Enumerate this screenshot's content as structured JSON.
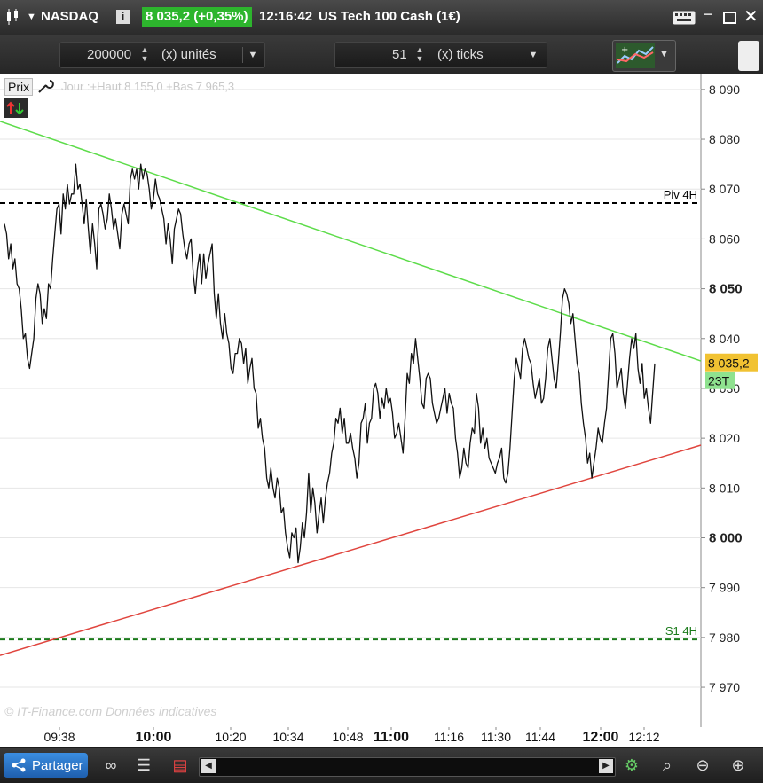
{
  "titlebar": {
    "market": "NASDAQ",
    "info_label": "i",
    "price_badge": "8 035,2 (+0,35%)",
    "time": "12:16:42",
    "instrument": "US Tech 100 Cash (1€)",
    "keyboard_icon": "keyboard-icon",
    "minimize_icon": "minimize-icon",
    "maximize_icon": "maximize-icon",
    "close_icon": "close-icon"
  },
  "toolbar": {
    "quantity": {
      "value": "200000",
      "unit_label": "(x) unités"
    },
    "ticks": {
      "value": "51",
      "unit_label": "(x) ticks"
    },
    "indicator_icon": "indicator-icon"
  },
  "chart_header": {
    "label": "Prix",
    "tool_icon": "wrench-icon",
    "day_info": "Jour :+Haut 8 155,0 +Bas 7 965,3",
    "arrows_icon": "up-down-arrows-icon"
  },
  "watermark": "© IT-Finance.com  Données indicatives",
  "colors": {
    "resistance": "#5ddc4a",
    "support": "#e0453e",
    "pivot": "#000000",
    "s1": "#1a7a1a",
    "price_tag": "#f1c232",
    "ticks_tag": "#8fe28f"
  },
  "chart_data": {
    "type": "line",
    "y_ticks": [
      "8 090",
      "8 080",
      "8 070",
      "8 060",
      "8 050",
      "8 040",
      "8 030",
      "8 020",
      "8 010",
      "8 000",
      "7 990",
      "7 980",
      "7 970"
    ],
    "y_tick_values": [
      8090,
      8080,
      8070,
      8060,
      8050,
      8040,
      8030,
      8020,
      8010,
      8000,
      7990,
      7980,
      7970
    ],
    "bold_ticks": [
      8050,
      8000
    ],
    "ylim": [
      7962,
      8093
    ],
    "x_ticks": [
      {
        "label": "09:38",
        "bold": false
      },
      {
        "label": "10:00",
        "bold": true
      },
      {
        "label": "10:20",
        "bold": false
      },
      {
        "label": "10:34",
        "bold": false
      },
      {
        "label": "10:48",
        "bold": false
      },
      {
        "label": "11:00",
        "bold": true
      },
      {
        "label": "11:16",
        "bold": false
      },
      {
        "label": "11:30",
        "bold": false
      },
      {
        "label": "11:44",
        "bold": false
      },
      {
        "label": "12:00",
        "bold": true
      },
      {
        "label": "12:12",
        "bold": false
      }
    ],
    "current_price": {
      "value": 8035.2,
      "label": "8 035,2"
    },
    "ticks_label": "23T",
    "pivot_lines": [
      {
        "name": "Piv 4H",
        "value": 8067.2,
        "color": "#000000"
      },
      {
        "name": "S1 4H",
        "value": 7979.6,
        "color": "#1a7a1a"
      }
    ],
    "trendlines": [
      {
        "role": "resistance",
        "from": [
          0,
          8083.6
        ],
        "to": [
          146,
          8035.5
        ],
        "color": "#5ddc4a"
      },
      {
        "role": "support",
        "from": [
          0,
          7976.4
        ],
        "to": [
          146,
          8018.6
        ],
        "color": "#e0453e"
      }
    ],
    "series": [
      {
        "values": [
          8063,
          8061,
          8056,
          8059,
          8054,
          8056,
          8051,
          8050,
          8046,
          8040,
          8041,
          8036,
          8034,
          8037,
          8040,
          8048,
          8051,
          8049,
          8043,
          8046,
          8044,
          8051,
          8050,
          8056,
          8061,
          8066,
          8067,
          8061,
          8069,
          8066,
          8071,
          8067,
          8069,
          8069,
          8075,
          8070,
          8071,
          8067,
          8063,
          8068,
          8062,
          8057,
          8063,
          8059,
          8054,
          8066,
          8067,
          8065,
          8062,
          8064,
          8069,
          8066,
          8062,
          8064,
          8061,
          8058,
          8065,
          8067,
          8065,
          8063,
          8072,
          8074,
          8072,
          8074,
          8070,
          8075,
          8072,
          8074,
          8073,
          8070,
          8066,
          8068,
          8072,
          8069,
          8068,
          8066,
          8064,
          8059,
          8063,
          8060,
          8055,
          8062,
          8064,
          8066,
          8065,
          8061,
          8058,
          8056,
          8059,
          8060,
          8053,
          8049,
          8054,
          8057,
          8051,
          8057,
          8052,
          8055,
          8057,
          8059,
          8049,
          8044,
          8049,
          8043,
          8040,
          8045,
          8041,
          8039,
          8034,
          8033,
          8037,
          8037,
          8040,
          8039,
          8035,
          8038,
          8031,
          8034,
          8036,
          8030,
          8029,
          8022,
          8024,
          8020,
          8018,
          8012,
          8010,
          8014,
          8010,
          8008,
          8012,
          8010,
          8005,
          8006,
          8001,
          7998,
          7996,
          8001,
          8000,
          8002,
          7995,
          7998,
          8003,
          8000,
          8005,
          8013,
          8005,
          8010,
          8007,
          8001,
          8005,
          8008,
          8003,
          8008,
          8011,
          8013,
          8017,
          8019,
          8024,
          8023,
          8026,
          8021,
          8024,
          8019,
          8019,
          8021,
          8018,
          8016,
          8012,
          8015,
          8023,
          8024,
          8027,
          8019,
          8023,
          8024,
          8030,
          8031,
          8029,
          8024,
          8028,
          8026,
          8030,
          8027,
          8028,
          8025,
          8020,
          8021,
          8023,
          8020,
          8017,
          8024,
          8033,
          8031,
          8037,
          8035,
          8040,
          8036,
          8032,
          8027,
          8026,
          8032,
          8033,
          8032,
          8027,
          8025,
          8023,
          8024,
          8026,
          8028,
          8030,
          8025,
          8029,
          8027,
          8026,
          8020,
          8017,
          8012,
          8014,
          8018,
          8015,
          8014,
          8019,
          8022,
          8021,
          8029,
          8026,
          8019,
          8022,
          8018,
          8020,
          8016,
          8015,
          8014,
          8013,
          8015,
          8016,
          8018,
          8012,
          8011,
          8013,
          8018,
          8025,
          8032,
          8036,
          8034,
          8032,
          8038,
          8040,
          8038,
          8036,
          8035,
          8031,
          8028,
          8030,
          8032,
          8027,
          8028,
          8032,
          8038,
          8040,
          8036,
          8032,
          8030,
          8035,
          8041,
          8048,
          8050,
          8049,
          8047,
          8043,
          8045,
          8040,
          8035,
          8033,
          8027,
          8023,
          8020,
          8015,
          8017,
          8012,
          8015,
          8018,
          8022,
          8020,
          8019,
          8023,
          8026,
          8033,
          8040,
          8041,
          8037,
          8030,
          8032,
          8034,
          8029,
          8026,
          8031,
          8036,
          8040,
          8038,
          8041,
          8034,
          8031,
          8035,
          8028,
          8030,
          8026,
          8023,
          8029,
          8035
        ]
      }
    ]
  },
  "bottombar": {
    "share_label": "Partager",
    "share_icon": "share-icon",
    "icons": [
      "binoculars-icon",
      "list-icon",
      "bars-icon",
      "chart-settings-icon",
      "zoom-fit-icon",
      "zoom-out-icon",
      "zoom-in-icon"
    ]
  }
}
